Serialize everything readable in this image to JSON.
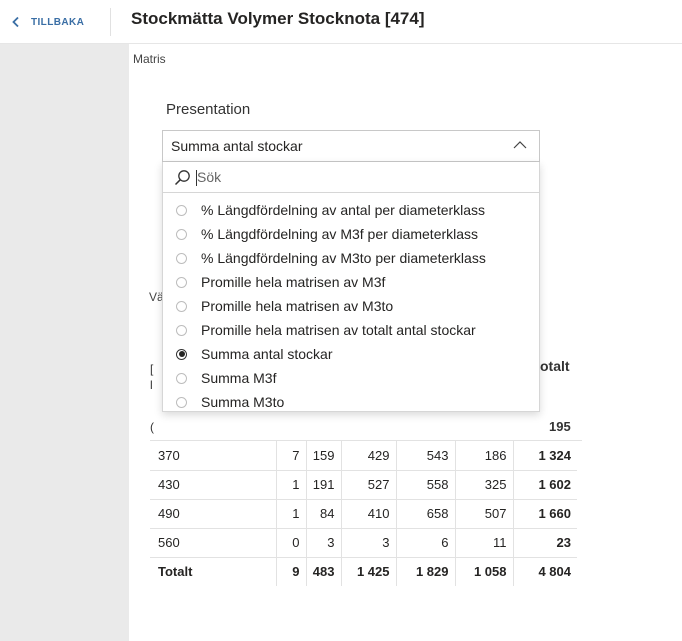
{
  "header": {
    "back_label": "TILLBAKA",
    "title": "Stockmätta Volymer Stocknota [474]"
  },
  "visual": {
    "label": "Matris",
    "slicer_title": "Presentation",
    "selected_value": "Summa antal stockar",
    "search_placeholder": "Sök",
    "options": [
      {
        "label": "% Längdfördelning av antal per diameterklass",
        "selected": false
      },
      {
        "label": "% Längdfördelning av M3f per diameterklass",
        "selected": false
      },
      {
        "label": "% Längdfördelning av M3to per diameterklass",
        "selected": false
      },
      {
        "label": "Promille hela matrisen av M3f",
        "selected": false
      },
      {
        "label": "Promille hela matrisen av M3to",
        "selected": false
      },
      {
        "label": "Promille hela matrisen av totalt antal stockar",
        "selected": false
      },
      {
        "label": "Summa antal stockar",
        "selected": true
      },
      {
        "label": "Summa M3f",
        "selected": false
      },
      {
        "label": "Summa M3to",
        "selected": false
      }
    ]
  },
  "matrix": {
    "partial_label": "Vä",
    "partial_row_header_1": "[",
    "partial_row_header_2": "l",
    "partial_row_header_3": "(",
    "total_col_header": "otalt",
    "first_row_total": "195",
    "rows": [
      {
        "label": "370",
        "values": [
          "7",
          "159",
          "429",
          "543",
          "186"
        ],
        "total": "1 324"
      },
      {
        "label": "430",
        "values": [
          "1",
          "191",
          "527",
          "558",
          "325"
        ],
        "total": "1 602"
      },
      {
        "label": "490",
        "values": [
          "1",
          "84",
          "410",
          "658",
          "507"
        ],
        "total": "1 660"
      },
      {
        "label": "560",
        "values": [
          "0",
          "3",
          "3",
          "6",
          "11"
        ],
        "total": "23"
      }
    ],
    "totals_row": {
      "label": "Totalt",
      "values": [
        "9",
        "483",
        "1 425",
        "1 829",
        "1 058"
      ],
      "total": "4 804"
    }
  },
  "colors": {
    "accent_link": "#3a6ea5",
    "left_pane": "#eaeaea",
    "text": "#252423"
  },
  "icons": {
    "back": "chevron-left-icon",
    "dropdown": "chevron-up-icon",
    "search": "search-icon"
  }
}
